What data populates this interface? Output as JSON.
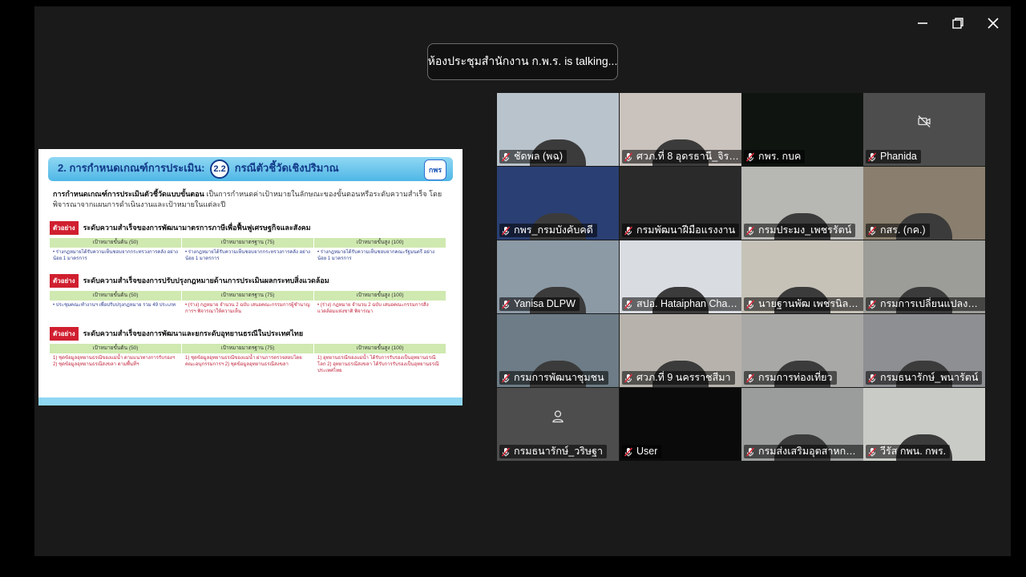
{
  "speaker_banner": "ห้องประชุมสำนักงาน ก.พ.ร. is talking...",
  "window_controls": {
    "minimize": "minimize",
    "restore": "restore",
    "close": "close"
  },
  "slide": {
    "title_prefix": "2. การกำหนดเกณฑ์การประเมิน:",
    "title_num": "2.2",
    "title_suffix": "กรณีตัวชี้วัดเชิงปริมาณ",
    "logo": "กพร",
    "intro_bold": "การกำหนดเกณฑ์การประเมินตัวชี้วัดแบบขั้นตอน",
    "intro_rest": " เป็นการกำหนดค่าเป้าหมายในลักษณะของขั้นตอนหรือระดับความสำเร็จ โดยพิจารณาจากแผนการดำเนินงานและเป้าหมายในแต่ละปี",
    "example_tag": "ตัวอย่าง",
    "col_headers": [
      "เป้าหมายขั้นต้น (50)",
      "เป้าหมายมาตรฐาน (75)",
      "เป้าหมายขั้นสูง (100)"
    ],
    "sections": [
      {
        "title": "ระดับความสำเร็จของการพัฒนามาตรการภาษีเพื่อฟื้นฟูเศรษฐกิจและสังคม",
        "cells": [
          "• ร่างกฎหมายได้รับความเห็นชอบจากกระทรวงการคลัง อย่างน้อย 1 มาตรการ",
          "• ร่างกฎหมายได้รับความเห็นชอบจากกระทรวงการคลัง อย่างน้อย 1 มาตรการ",
          "• ร่างกฎหมายได้รับความเห็นชอบจากคณะรัฐมนตรี อย่างน้อย 1 มาตรการ"
        ]
      },
      {
        "title": "ระดับความสำเร็จของการปรับปรุงกฎหมายด้านการประเมินผลกระทบสิ่งแวดล้อม",
        "cells": [
          "• ประชุมคณะทำงานฯ เพื่อปรับปรุงกฎหมาย รวม 49 ประเภท",
          "• (ร่าง) กฎหมาย จำนวน 2 ฉบับ เสนอคณะกรรมการผู้ชำนาญการฯ พิจารณาให้ความเห็น",
          "• (ร่าง) กฎหมาย จำนวน 2 ฉบับ เสนอคณะกรรมการสิ่งแวดล้อมแห่งชาติ พิจารณา"
        ]
      },
      {
        "title": "ระดับความสำเร็จของการพัฒนาและยกระดับอุทยานธรณีในประเทศไทย",
        "cells": [
          "1) ชุดข้อมูลอุทยานธรณีของแม่น้ำ ตามแนวทางการรับรองฯ  2) ชุดข้อมูลอุทยานธรณีสงขลา ตามพื้นที่ฯ",
          "1) ชุดข้อมูลอุทยานธรณีของแม่น้ำ ผ่านการตรวจสอบโดยคณะอนุกรรมการฯ  2) ชุดข้อมูลอุทยานธรณีสงขลา",
          "1) อุทยานธรณีของแม่น้ำ ได้รับการรับรองเป็นอุทยานธรณีโลก  2) อุทยานธรณีสงขลา ได้รับการรับรองเป็นอุทยานธรณีประเทศไทย"
        ]
      }
    ]
  },
  "participants": [
    {
      "name": "ชัดพล (พฉ)",
      "bg": "#b9c3cc",
      "muted": true
    },
    {
      "name": "ศวภ.ที่ 8 อุดรธานี_จิราพร ...",
      "bg": "#c9c2bd",
      "muted": true
    },
    {
      "name": "กพร. กบค",
      "bg": "#0f1410",
      "muted": true
    },
    {
      "name": "Phanida",
      "bg": "#4d4d4d",
      "muted": true,
      "video_off": true
    },
    {
      "name": "กพร_กรมบังคับคดี",
      "bg": "#2a3f73",
      "muted": true
    },
    {
      "name": "กรมพัฒนาฝีมือแรงงาน",
      "bg": "#2a2a2a",
      "muted": true
    },
    {
      "name": "กรมประมง_เพชรรัตน์",
      "bg": "#b7b8b4",
      "muted": true
    },
    {
      "name": "กสร. (กค.)",
      "bg": "#8a7f6e",
      "muted": true
    },
    {
      "name": "Yanisa DLPW",
      "bg": "#8c9aa6",
      "muted": true
    },
    {
      "name": "สปอ. Hataiphan Chantui",
      "bg": "#d9dde2",
      "muted": true
    },
    {
      "name": "นายฐานพัฒ เพชรนิล_กรม...",
      "bg": "#c6c2b8",
      "muted": true
    },
    {
      "name": "กรมการเปลี่ยนแปลงสภาพ...",
      "bg": "#9c9c98",
      "muted": true
    },
    {
      "name": "กรมการพัฒนาชุมชน",
      "bg": "#6d7c86",
      "muted": true
    },
    {
      "name": "ศวภ.ที่ 9 นครราชสีมา",
      "bg": "#b7b3ac",
      "muted": true
    },
    {
      "name": "กรมการท่องเที่ยว",
      "bg": "#a8a8a6",
      "muted": true
    },
    {
      "name": "กรมธนารักษ์_พนารัตน์",
      "bg": "#8e8f92",
      "muted": true
    },
    {
      "name": "กรมธนารักษ์_วริษฐา",
      "bg": "#4d4d4d",
      "muted": true,
      "avatar": true
    },
    {
      "name": "User",
      "bg": "#0a0a0a",
      "muted": true
    },
    {
      "name": "กรมส่งเสริมอุตสาหกรรม",
      "bg": "#9a9d9c",
      "muted": true
    },
    {
      "name": "วีรัส กพน. กพร.",
      "bg": "#c9cbc6",
      "muted": true
    }
  ]
}
